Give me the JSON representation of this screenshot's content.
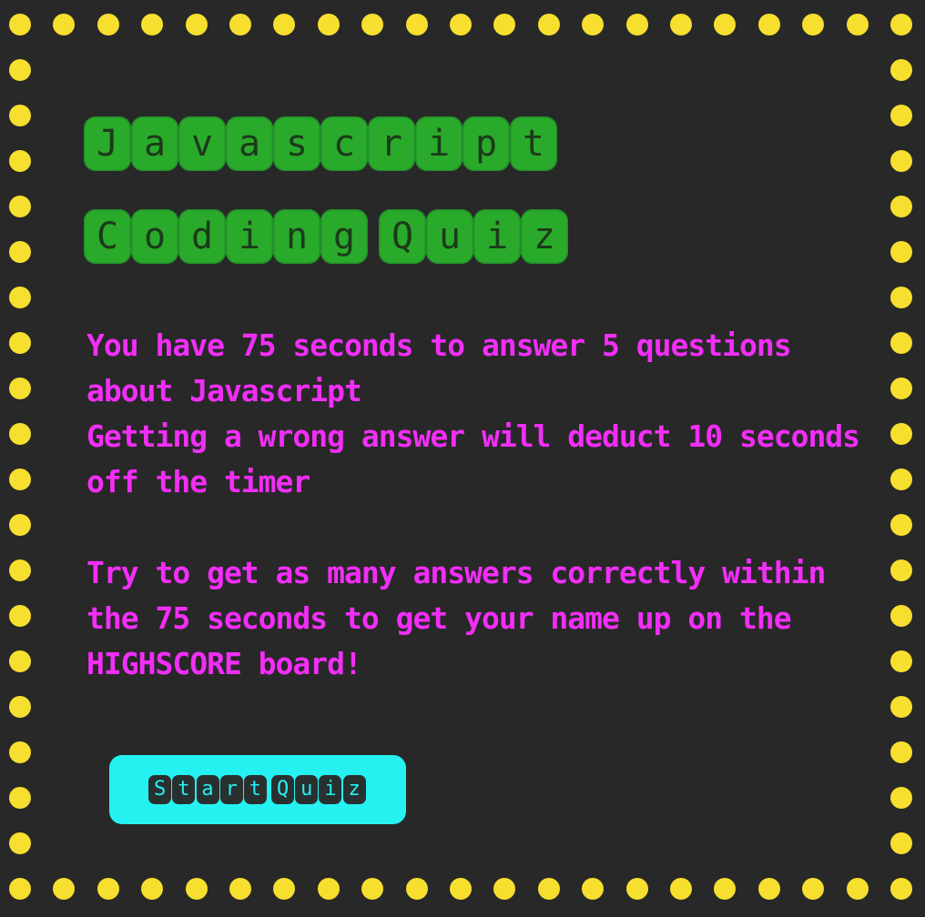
{
  "colors": {
    "background": "#282828",
    "dot": "#f7df2f",
    "title_tile": "#2aaa2a",
    "intro_text": "#f22ef7",
    "button": "#26f1f1"
  },
  "title": {
    "line1": "Javascript",
    "line2": "Coding Quiz"
  },
  "intro": {
    "paragraph1_line1": "You have 75 seconds to answer 5 questions about Javascript",
    "paragraph1_line2": "Getting a wrong answer will deduct 10 seconds off the timer",
    "paragraph2": "Try to get as many answers correctly within the 75 seconds to get your name up on the HIGHSCORE board!"
  },
  "start_button": {
    "label": "Start Quiz"
  }
}
